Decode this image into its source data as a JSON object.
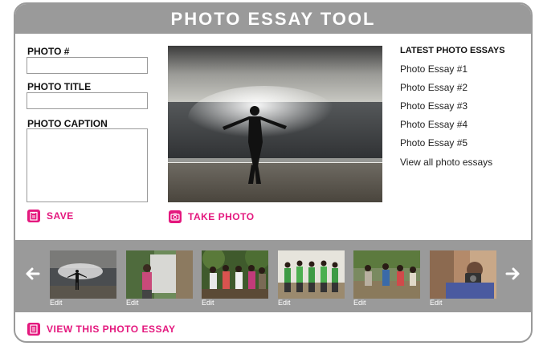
{
  "app": {
    "title": "PHOTO ESSAY TOOL"
  },
  "form": {
    "photo_number_label": "PHOTO #",
    "photo_number_value": "",
    "photo_title_label": "PHOTO TITLE",
    "photo_title_value": "",
    "photo_caption_label": "PHOTO CAPTION",
    "photo_caption_value": ""
  },
  "actions": {
    "save": "SAVE",
    "take_photo": "TAKE PHOTO",
    "view_essay": "VIEW THIS PHOTO ESSAY"
  },
  "latest": {
    "title": "LATEST PHOTO ESSAYS",
    "items": [
      "Photo Essay #1",
      "Photo Essay #2",
      "Photo Essay #3",
      "Photo Essay #4",
      "Photo Essay #5"
    ],
    "view_all": "View all photo essays"
  },
  "thumbnails": {
    "edit_labels": [
      "Edit",
      "Edit",
      "Edit",
      "Edit",
      "Edit",
      "Edit"
    ]
  },
  "icons": {
    "save": "save-icon",
    "camera": "camera-icon",
    "view": "document-icon",
    "prev": "arrow-left-icon",
    "next": "arrow-right-icon"
  },
  "colors": {
    "accent": "#e4187e",
    "frame_gray": "#9a9a9a",
    "white": "#ffffff"
  }
}
